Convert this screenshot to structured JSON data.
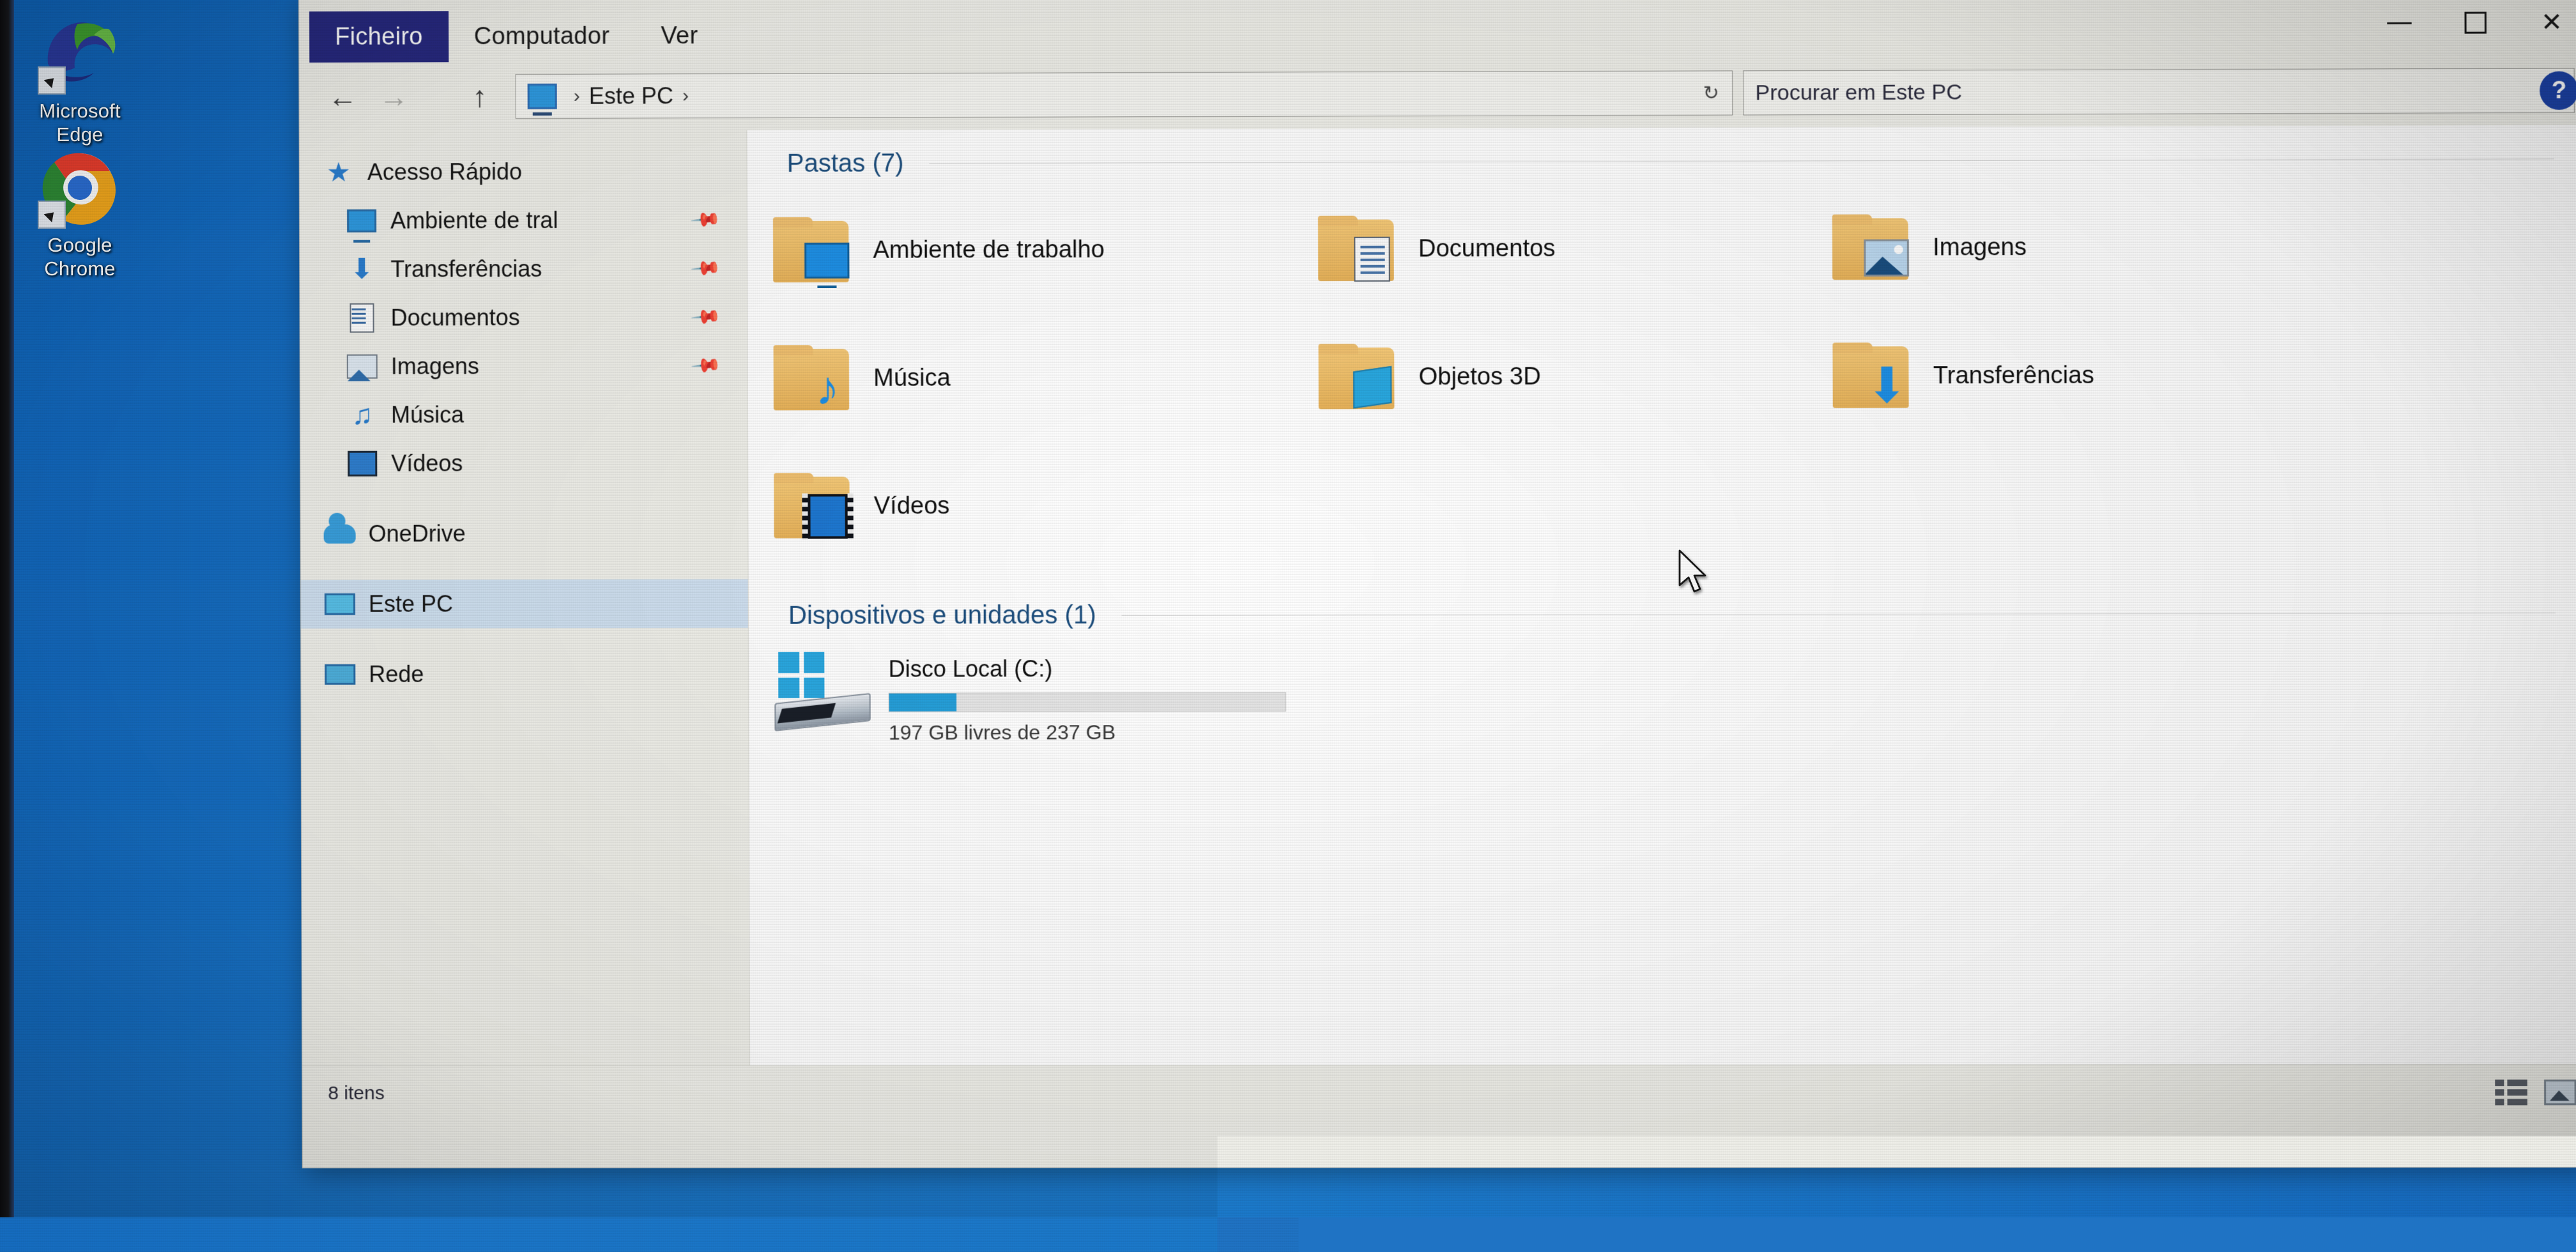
{
  "desktop": {
    "icons": [
      {
        "name": "Microsoft Edge",
        "line1": "Microsoft",
        "line2": "Edge",
        "icon": "edge-icon"
      },
      {
        "name": "Google Chrome",
        "line1": "Google",
        "line2": "Chrome",
        "icon": "chrome-icon"
      }
    ]
  },
  "window": {
    "ribbon_tabs": [
      {
        "label": "Ficheiro",
        "active": true
      },
      {
        "label": "Computador",
        "active": false
      },
      {
        "label": "Ver",
        "active": false
      }
    ],
    "controls": {
      "minimize": "—",
      "maximize": "□",
      "close": "✕",
      "ribbon_expand": "ⱟ",
      "help": "?"
    }
  },
  "nav": {
    "back": "←",
    "forward": "→",
    "recent": "ⱟ",
    "up": "↑",
    "breadcrumb": {
      "root_icon": "this-pc-icon",
      "sep1": "›",
      "label": "Este PC",
      "sep2": "›"
    },
    "address_dropdown": "ⱟ",
    "refresh": "↻",
    "search_placeholder": "Procurar em Este PC",
    "search_icon": "⌕"
  },
  "sidebar": {
    "items": [
      {
        "label": "Acesso Rápido",
        "icon": "star-icon",
        "indent": false,
        "pinned": false,
        "selected": false
      },
      {
        "label": "Ambiente de tral",
        "icon": "desktop-icon",
        "indent": true,
        "pinned": true,
        "selected": false
      },
      {
        "label": "Transferências",
        "icon": "downloads-icon",
        "indent": true,
        "pinned": true,
        "selected": false
      },
      {
        "label": "Documentos",
        "icon": "documents-icon",
        "indent": true,
        "pinned": true,
        "selected": false
      },
      {
        "label": "Imagens",
        "icon": "pictures-icon",
        "indent": true,
        "pinned": true,
        "selected": false
      },
      {
        "label": "Música",
        "icon": "music-icon",
        "indent": true,
        "pinned": false,
        "selected": false
      },
      {
        "label": "Vídeos",
        "icon": "videos-icon",
        "indent": true,
        "pinned": false,
        "selected": false
      },
      {
        "label": "OneDrive",
        "icon": "cloud-icon",
        "indent": false,
        "pinned": false,
        "selected": false
      },
      {
        "label": "Este PC",
        "icon": "this-pc-icon",
        "indent": false,
        "pinned": false,
        "selected": true
      },
      {
        "label": "Rede",
        "icon": "network-icon",
        "indent": false,
        "pinned": false,
        "selected": false
      }
    ]
  },
  "content": {
    "folders_group": {
      "chevron": "ⱟ",
      "title": "Pastas (7)"
    },
    "folders": [
      {
        "label": "Ambiente de trabalho",
        "icon": "folder-desktop-icon"
      },
      {
        "label": "Documentos",
        "icon": "folder-documents-icon"
      },
      {
        "label": "Imagens",
        "icon": "folder-pictures-icon"
      },
      {
        "label": "Música",
        "icon": "folder-music-icon"
      },
      {
        "label": "Objetos 3D",
        "icon": "folder-3dobjects-icon"
      },
      {
        "label": "Transferências",
        "icon": "folder-downloads-icon"
      },
      {
        "label": "Vídeos",
        "icon": "folder-videos-icon"
      }
    ],
    "devices_group": {
      "chevron": "ⱟ",
      "title": "Dispositivos e unidades (1)"
    },
    "drive": {
      "name": "Disco Local (C:)",
      "free_text": "197 GB livres de 237 GB",
      "used_percent": 17,
      "bar_color": "#26a0da"
    }
  },
  "statusbar": {
    "items_text": "8 itens",
    "view_details_icon": "details-view-icon",
    "view_tiles_icon": "large-icons-view-icon"
  },
  "colors": {
    "desktop_blue": "#1b74c6",
    "file_tab_blue": "#27297f",
    "selection_blue": "#cfe0f0",
    "group_header_blue": "#1d4f7f",
    "accent": "#26a0da"
  }
}
